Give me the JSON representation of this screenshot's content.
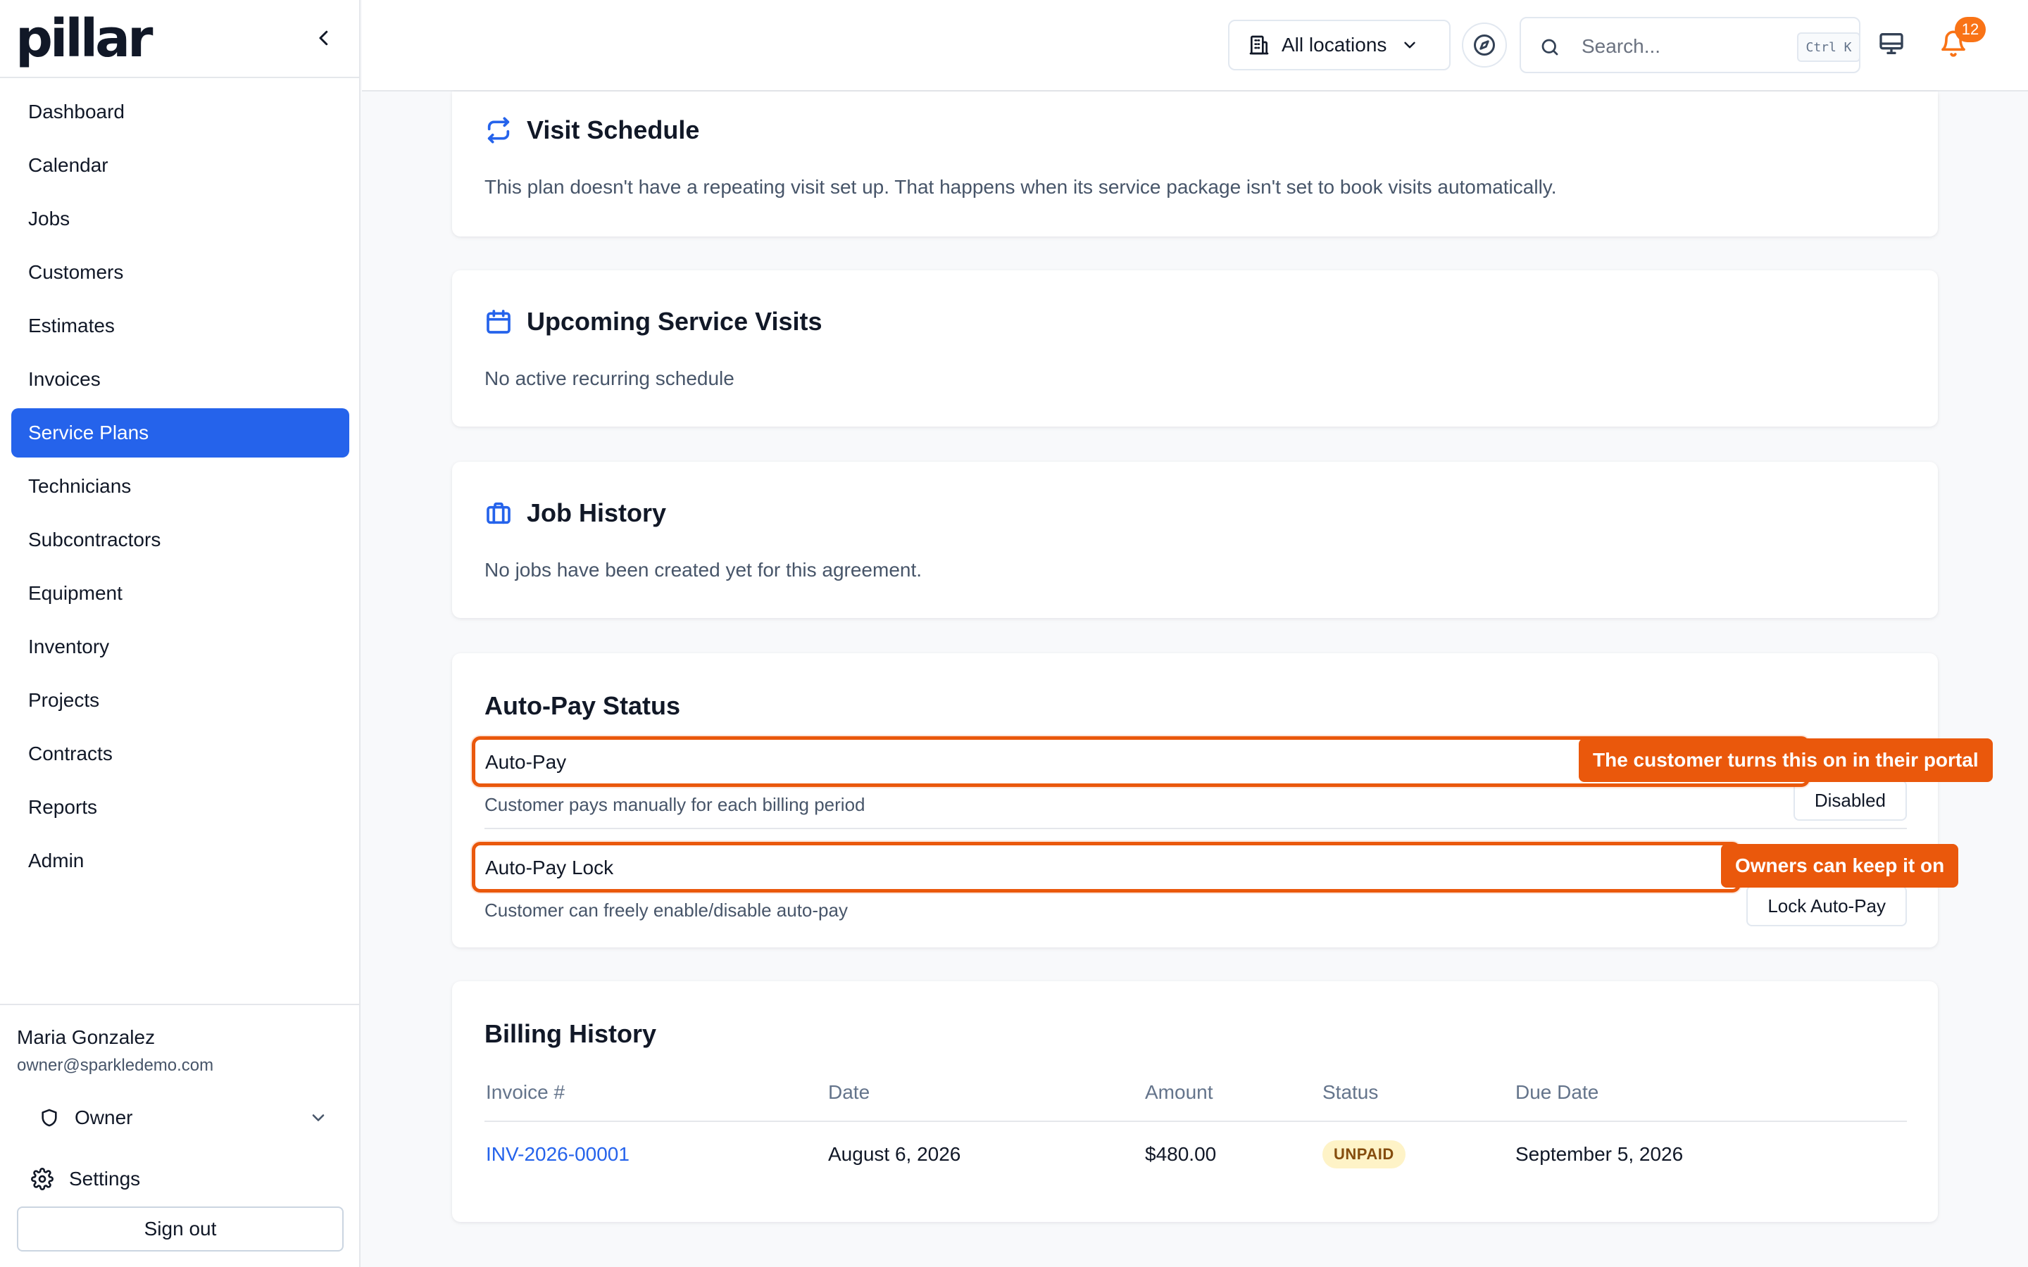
{
  "brand": {
    "logo_text": "pillar"
  },
  "sidebar": {
    "items": [
      {
        "label": "Dashboard",
        "active": false
      },
      {
        "label": "Calendar",
        "active": false
      },
      {
        "label": "Jobs",
        "active": false
      },
      {
        "label": "Customers",
        "active": false
      },
      {
        "label": "Estimates",
        "active": false
      },
      {
        "label": "Invoices",
        "active": false
      },
      {
        "label": "Service Plans",
        "active": true
      },
      {
        "label": "Technicians",
        "active": false
      },
      {
        "label": "Subcontractors",
        "active": false
      },
      {
        "label": "Equipment",
        "active": false
      },
      {
        "label": "Inventory",
        "active": false
      },
      {
        "label": "Projects",
        "active": false
      },
      {
        "label": "Contracts",
        "active": false
      },
      {
        "label": "Reports",
        "active": false
      },
      {
        "label": "Admin",
        "active": false
      }
    ],
    "user": {
      "name": "Maria Gonzalez",
      "email": "owner@sparkledemo.com"
    },
    "role": "Owner",
    "settings_label": "Settings",
    "signout_label": "Sign out"
  },
  "topbar": {
    "location_label": "All locations",
    "search_placeholder": "Search...",
    "search_shortcut": "Ctrl K",
    "notification_count": "12"
  },
  "visit_schedule": {
    "title": "Visit Schedule",
    "text": "This plan doesn't have a repeating visit set up. That happens when its service package isn't set to book visits automatically."
  },
  "upcoming_visits": {
    "title": "Upcoming Service Visits",
    "text": "No active recurring schedule"
  },
  "job_history": {
    "title": "Job History",
    "text": "No jobs have been created yet for this agreement."
  },
  "autopay": {
    "title": "Auto-Pay Status",
    "rows": [
      {
        "label": "Auto-Pay",
        "sub": "Customer pays manually for each billing period",
        "button": "Disabled"
      },
      {
        "label": "Auto-Pay Lock",
        "sub": "Customer can freely enable/disable auto-pay",
        "button": "Lock Auto-Pay"
      }
    ],
    "callouts": [
      "The customer turns this on in their portal",
      "Owners can keep it on"
    ]
  },
  "billing": {
    "title": "Billing History",
    "headers": [
      "Invoice #",
      "Date",
      "Amount",
      "Status",
      "Due Date"
    ],
    "rows": [
      {
        "invoice": "INV-2026-00001",
        "date": "August 6, 2026",
        "amount": "$480.00",
        "status": "UNPAID",
        "due": "September 5, 2026"
      }
    ]
  },
  "colors": {
    "accent": "#2563eb",
    "highlight": "#ea580c",
    "badge": "#f97316"
  }
}
